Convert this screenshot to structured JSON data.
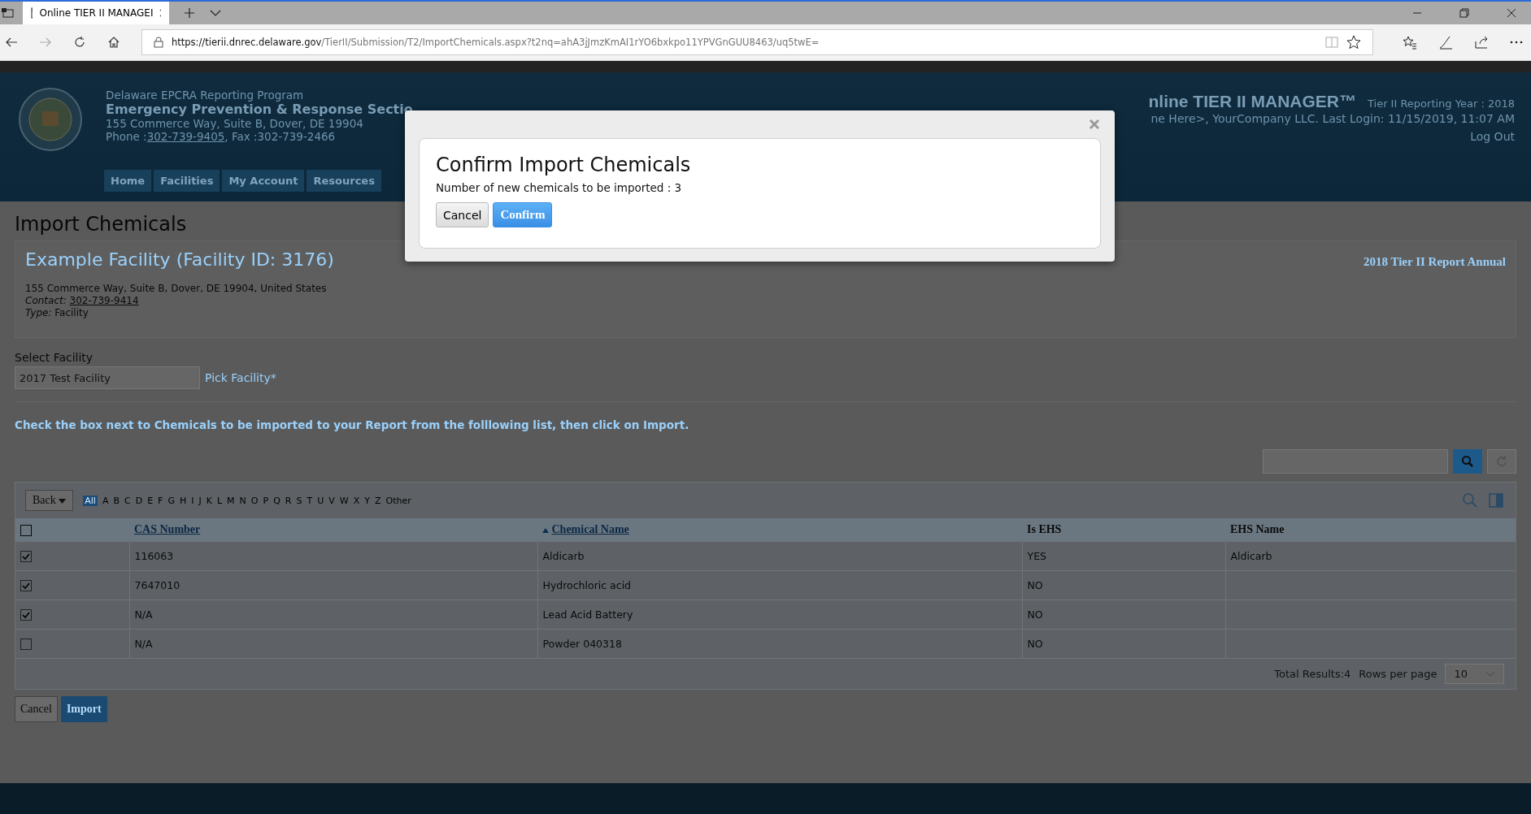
{
  "browser": {
    "tab_title": "Online TIER II MANAGEI",
    "url_host": "https://tierii.dnrec.delaware.gov",
    "url_path": "/TierII/Submission/T2/ImportChemicals.aspx?t2nq=ahA3jJmzKmAI1rYO6bxkpo11YPVGnGUU8463/uq5twE="
  },
  "header": {
    "program": "Delaware EPCRA Reporting Program",
    "section": "Emergency Prevention & Response Sectio",
    "address": "155 Commerce Way, Suite B, Dover, DE 19904",
    "phone_label": "Phone :",
    "phone": "302-739-9405",
    "fax": ", Fax :302-739-2466",
    "nav": [
      {
        "label": "Home",
        "selected": false
      },
      {
        "label": "Facilities",
        "selected": false
      },
      {
        "label": "My Account",
        "selected": false
      },
      {
        "label": "Resources",
        "selected": false
      }
    ],
    "app_title": "nline TIER II MANAGER™",
    "reporting_year": "Tier II Reporting Year : 2018",
    "user_line": "ne Here>, YourCompany LLC.   Last Login: 11/15/2019, 11:07 AM",
    "logout": "Log Out"
  },
  "modal": {
    "title": "Confirm Import Chemicals",
    "message": "Number of new chemicals to be imported : 3",
    "buttons": [
      {
        "label": "Cancel",
        "kind": "default"
      },
      {
        "label": "Confirm",
        "kind": "primary"
      }
    ]
  },
  "page": {
    "heading": "Import Chemicals",
    "facility": {
      "name": "Example Facility (Facility ID: 3176)",
      "report": "2018 Tier II Report Annual",
      "address": "155 Commerce Way, Suite B, Dover, DE 19904, United States",
      "contact_label": "Contact:",
      "contact": "302-739-9414",
      "type_label": "Type:",
      "type": "Facility"
    },
    "select_label": "Select Facility",
    "select_value": "2017 Test Facility",
    "pick_link": "Pick Facility*",
    "instruction": "Check the box next to Chemicals to be imported to your Report from the folllowing list, then click on Import.",
    "table": {
      "back_button": "Back",
      "letters": [
        {
          "label": "All",
          "selected": true
        },
        {
          "label": "A",
          "selected": false
        },
        {
          "label": "B",
          "selected": false
        },
        {
          "label": "C",
          "selected": false
        },
        {
          "label": "D",
          "selected": false
        },
        {
          "label": "E",
          "selected": false
        },
        {
          "label": "F",
          "selected": false
        },
        {
          "label": "G",
          "selected": false
        },
        {
          "label": "H",
          "selected": false
        },
        {
          "label": "I",
          "selected": false
        },
        {
          "label": "J",
          "selected": false
        },
        {
          "label": "K",
          "selected": false
        },
        {
          "label": "L",
          "selected": false
        },
        {
          "label": "M",
          "selected": false
        },
        {
          "label": "N",
          "selected": false
        },
        {
          "label": "O",
          "selected": false
        },
        {
          "label": "P",
          "selected": false
        },
        {
          "label": "Q",
          "selected": false
        },
        {
          "label": "R",
          "selected": false
        },
        {
          "label": "S",
          "selected": false
        },
        {
          "label": "T",
          "selected": false
        },
        {
          "label": "U",
          "selected": false
        },
        {
          "label": "V",
          "selected": false
        },
        {
          "label": "W",
          "selected": false
        },
        {
          "label": "X",
          "selected": false
        },
        {
          "label": "Y",
          "selected": false
        },
        {
          "label": "Z",
          "selected": false
        },
        {
          "label": "Other",
          "selected": false
        }
      ],
      "header_checked": false,
      "columns": [
        {
          "label": "CAS Number",
          "kind": "link",
          "sorted_ascending": false
        },
        {
          "label": "Chemical Name",
          "kind": "link",
          "sorted_ascending": true
        },
        {
          "label": "Is EHS",
          "kind": "plain",
          "sorted_ascending": false
        },
        {
          "label": "EHS Name",
          "kind": "plain",
          "sorted_ascending": false
        }
      ],
      "rows": [
        {
          "checked": true,
          "cells": [
            "116063",
            "Aldicarb",
            "YES",
            "Aldicarb"
          ]
        },
        {
          "checked": true,
          "cells": [
            "7647010",
            "Hydrochloric acid",
            "NO",
            ""
          ]
        },
        {
          "checked": true,
          "cells": [
            "N/A",
            "Lead Acid Battery",
            "NO",
            ""
          ]
        },
        {
          "checked": false,
          "cells": [
            "N/A",
            "Powder 040318",
            "NO",
            ""
          ]
        }
      ],
      "total": "Total Results:4",
      "rows_per_page_label": "Rows per page",
      "rows_per_page": "10"
    },
    "actions": [
      {
        "label": "Cancel",
        "kind": "default"
      },
      {
        "label": "Import",
        "kind": "primary"
      }
    ]
  }
}
